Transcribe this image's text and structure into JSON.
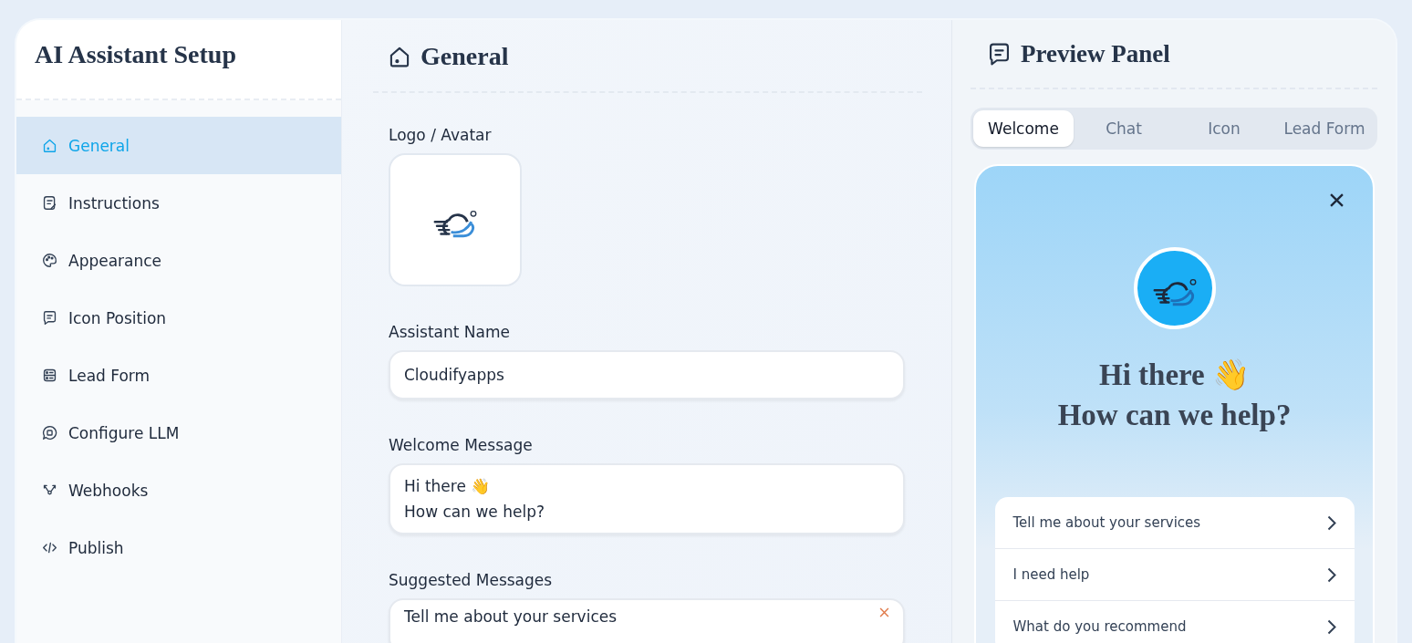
{
  "sidebar": {
    "title": "AI Assistant Setup",
    "items": [
      {
        "label": "General",
        "selected": true
      },
      {
        "label": "Instructions",
        "selected": false
      },
      {
        "label": "Appearance",
        "selected": false
      },
      {
        "label": "Icon Position",
        "selected": false
      },
      {
        "label": "Lead Form",
        "selected": false
      },
      {
        "label": "Configure LLM",
        "selected": false
      },
      {
        "label": "Webhooks",
        "selected": false
      },
      {
        "label": "Publish",
        "selected": false
      }
    ]
  },
  "main": {
    "title": "General",
    "logo_label": "Logo / Avatar",
    "fields": [
      {
        "kind": "input",
        "label": "Assistant Name",
        "value": "Cloudifyapps"
      },
      {
        "kind": "textarea",
        "label": "Welcome Message",
        "value": "Hi there 👋\nHow can we help?"
      },
      {
        "kind": "list",
        "label": "Suggested Messages",
        "items": [
          "Tell me about your services"
        ]
      }
    ]
  },
  "preview": {
    "title": "Preview Panel",
    "tabs": [
      {
        "label": "Welcome",
        "selected": true
      },
      {
        "label": "Chat",
        "selected": false
      },
      {
        "label": "Icon",
        "selected": false
      },
      {
        "label": "Lead Form",
        "selected": false
      }
    ],
    "greeting": [
      "Hi there 👋",
      "How can we help?"
    ],
    "suggestions": [
      "Tell me about your services",
      "I need help",
      "What do you recommend"
    ]
  }
}
